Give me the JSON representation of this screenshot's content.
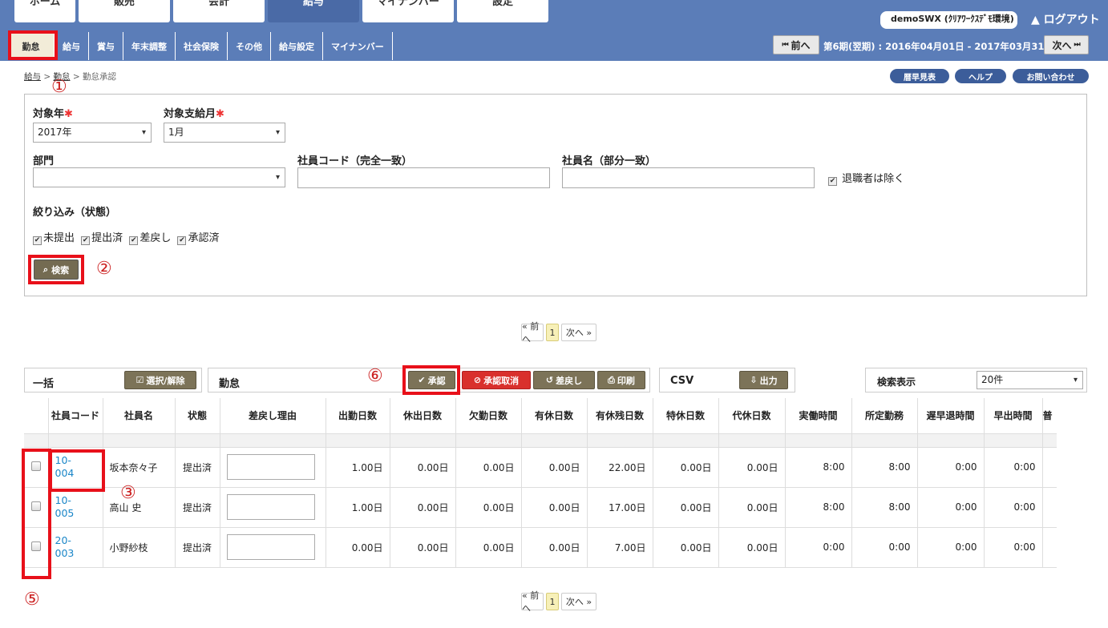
{
  "main_tabs": [
    {
      "label": "ホーム",
      "active": false
    },
    {
      "label": "販売",
      "active": false
    },
    {
      "label": "会計",
      "active": false
    },
    {
      "label": "給与",
      "active": true
    },
    {
      "label": "マイナンバー",
      "active": false
    },
    {
      "label": "設定",
      "active": false
    }
  ],
  "user_label": "demoSWX (ｸﾘｱﾜｰｸｽﾃﾞﾓ環境)",
  "logout_label": "ログアウト",
  "sub_tabs": [
    "勤怠",
    "給与",
    "賞与",
    "年末調整",
    "社会保険",
    "その他",
    "給与設定",
    "マイナンバー"
  ],
  "prev_label": "前へ",
  "next_label": "次へ",
  "period_text": "第6期(翌期) : 2016年04月01日 - 2017年03月31日",
  "breadcrumb": {
    "level1": "給与",
    "level2": "勤怠",
    "current": "勤怠承認",
    "sep": ">"
  },
  "header_buttons": {
    "calendar": "暦早見表",
    "help": "ヘルプ",
    "contact": "お問い合わせ"
  },
  "annotations": {
    "n1": "①",
    "n2": "②",
    "n3": "③",
    "n5": "⑤",
    "n6": "⑥"
  },
  "filter": {
    "year_label": "対象年",
    "year_value": "2017年",
    "month_label": "対象支給月",
    "month_value": "1月",
    "required_mark": "✱",
    "dept_label": "部門",
    "dept_value": "",
    "code_label": "社員コード（完全一致）",
    "name_label": "社員名（部分一致）",
    "exclude_retired": "退職者は除く",
    "status_label": "絞り込み（状態）",
    "statuses": [
      "未提出",
      "提出済",
      "差戻し",
      "承認済"
    ],
    "search_button": "検索"
  },
  "pager": {
    "prev": "« 前へ",
    "page": "1",
    "next": "次へ »"
  },
  "toolbar": {
    "bulk_label": "一括",
    "select_toggle": "選択/解除",
    "kintai_label": "勤怠",
    "approve": "承認",
    "cancel_approve": "承認取消",
    "sendback": "差戻し",
    "print": "印刷",
    "csv_label": "CSV",
    "export": "出力",
    "display_label": "検索表示",
    "display_value": "20件"
  },
  "columns": [
    "",
    "社員コード",
    "社員名",
    "状態",
    "差戻し理由",
    "出勤日数",
    "休出日数",
    "欠勤日数",
    "有休日数",
    "有休残日数",
    "特休日数",
    "代休日数",
    "実働時間",
    "所定勤務",
    "遅早退時間",
    "早出時間",
    "普"
  ],
  "rows": [
    {
      "code_line1": "10-",
      "code_line2": "004",
      "name": "坂本奈々子",
      "status": "提出済",
      "work_days": "1.00日",
      "holiday_work": "0.00日",
      "absent": "0.00日",
      "paid_leave": "0.00日",
      "paid_leave_remaining": "22.00日",
      "special_leave": "0.00日",
      "sub_leave": "0.00日",
      "actual_hours": "8:00",
      "scheduled": "8:00",
      "late_early": "0:00",
      "early_start": "0:00"
    },
    {
      "code_line1": "10-",
      "code_line2": "005",
      "name": "高山 史",
      "status": "提出済",
      "work_days": "1.00日",
      "holiday_work": "0.00日",
      "absent": "0.00日",
      "paid_leave": "0.00日",
      "paid_leave_remaining": "17.00日",
      "special_leave": "0.00日",
      "sub_leave": "0.00日",
      "actual_hours": "8:00",
      "scheduled": "8:00",
      "late_early": "0:00",
      "early_start": "0:00"
    },
    {
      "code_line1": "20-",
      "code_line2": "003",
      "name": "小野紗枝",
      "status": "提出済",
      "work_days": "0.00日",
      "holiday_work": "0.00日",
      "absent": "0.00日",
      "paid_leave": "0.00日",
      "paid_leave_remaining": "7.00日",
      "special_leave": "0.00日",
      "sub_leave": "0.00日",
      "actual_hours": "0:00",
      "scheduled": "0:00",
      "late_early": "0:00",
      "early_start": "0:00"
    }
  ],
  "colors": {
    "nav": "#5b7db8",
    "highlight": "#e8101a",
    "olive": "#7c7358",
    "danger": "#d9302c",
    "link": "#1a86c8"
  }
}
